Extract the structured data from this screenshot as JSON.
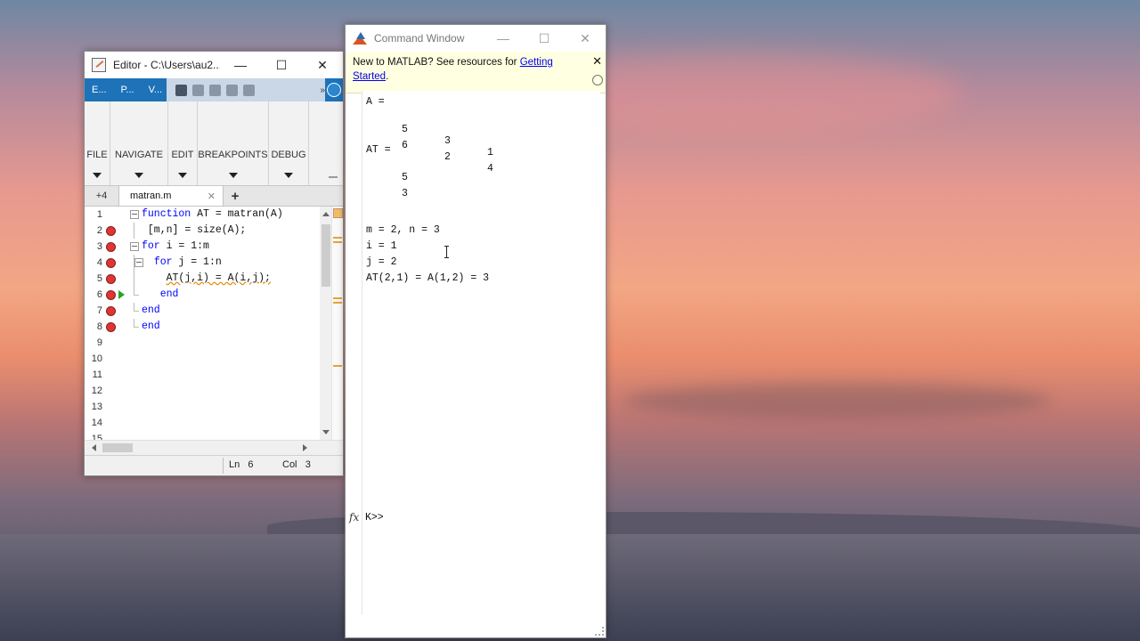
{
  "editor": {
    "title": "Editor - C:\\Users\\au2...",
    "ribbon_tabs": [
      "E...",
      "P...",
      "V..."
    ],
    "sections": [
      "FILE",
      "NAVIGATE",
      "EDIT",
      "BREAKPOINTS",
      "DEBUG"
    ],
    "tab_more": "+4",
    "tab_name": "matran.m",
    "add_tab": "+",
    "line_numbers": [
      "1",
      "2",
      "3",
      "4",
      "5",
      "6",
      "7",
      "8",
      "9",
      "10",
      "11",
      "12",
      "13",
      "14",
      "15"
    ],
    "code_lines": [
      {
        "kw": "function",
        "rest": " AT = matran(A)"
      },
      {
        "kw": "",
        "rest": "[m,n] = size(A);"
      },
      {
        "kw": "for",
        "rest": " i = 1:m"
      },
      {
        "kw": "for",
        "rest": " j = 1:n"
      },
      {
        "kw": "",
        "rest": "AT(j,i) = A(i,j);"
      },
      {
        "kw": "end",
        "rest": ""
      },
      {
        "kw": "end",
        "rest": ""
      },
      {
        "kw": "end",
        "rest": ""
      }
    ],
    "status_ln_label": "Ln",
    "status_ln": "6",
    "status_col_label": "Col",
    "status_col": "3"
  },
  "cmd": {
    "title": "Command Window",
    "banner_text": "New to MATLAB? See resources for ",
    "banner_link1": "Getting",
    "banner_link2": "Started",
    "banner_end": ".",
    "a_label": "A =",
    "a_row1": [
      "5",
      "3",
      "1"
    ],
    "a_row2": [
      "6",
      "2",
      "4"
    ],
    "at_label": "AT =",
    "at_col": [
      "5",
      "3"
    ],
    "line_mn": "m = 2, n = 3",
    "line_i": "i = 1",
    "line_j": "j = 2",
    "line_at": "AT(2,1) = A(1,2) = 3",
    "fx": "fx",
    "prompt": "K>>"
  }
}
